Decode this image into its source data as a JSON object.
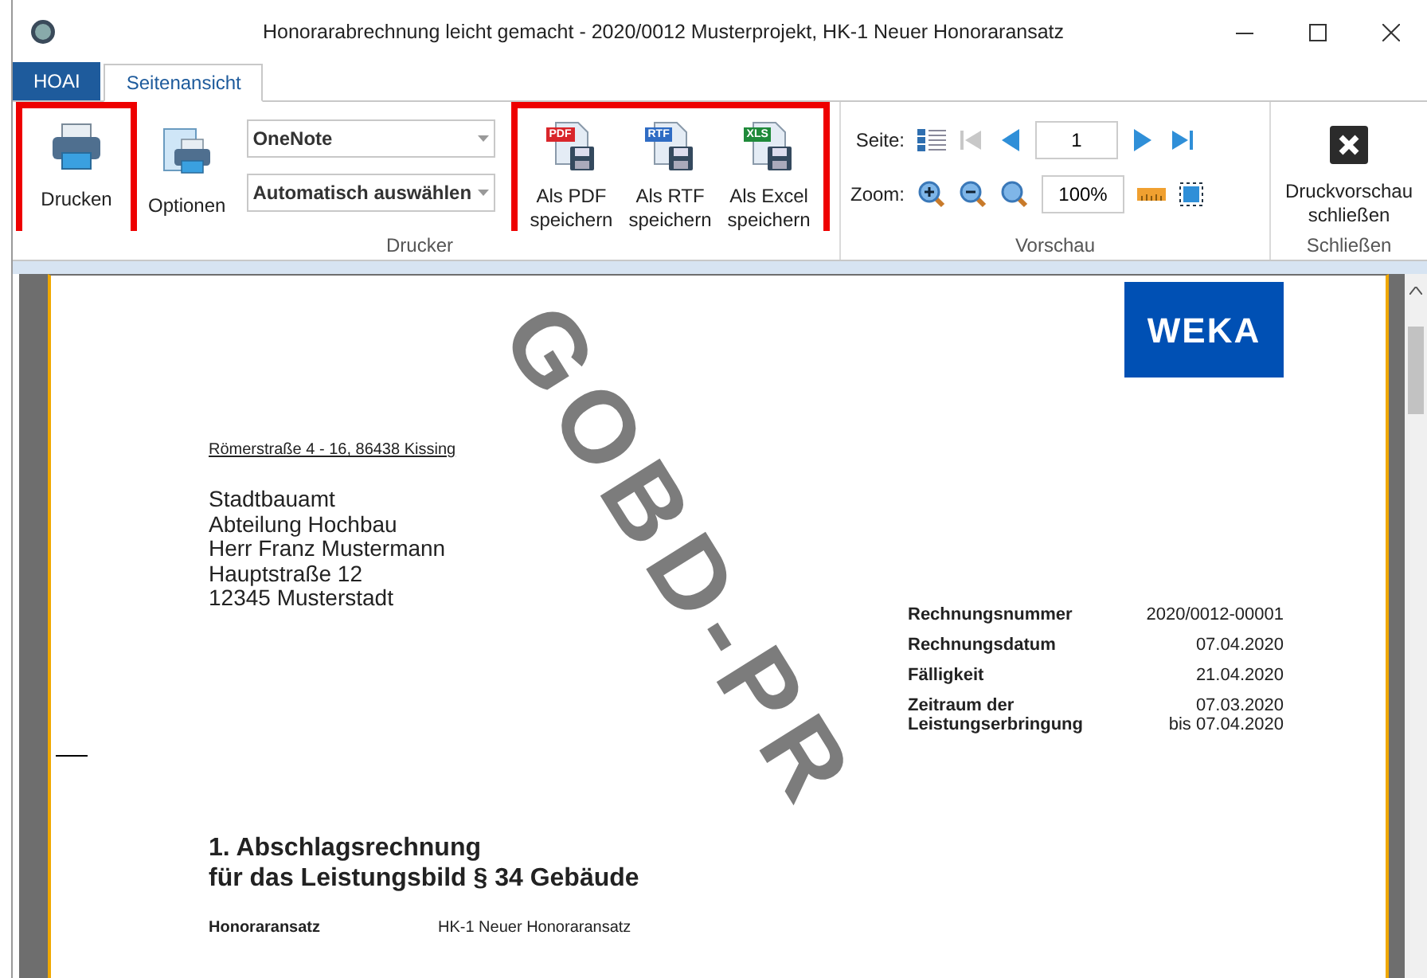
{
  "window": {
    "title": "Honorarabrechnung leicht gemacht - 2020/0012 Musterprojekt, HK-1 Neuer Honoraransatz"
  },
  "tabs": [
    {
      "label": "HOAI",
      "kind": "file",
      "selected": false
    },
    {
      "label": "Seitenansicht",
      "kind": "tab",
      "selected": true
    }
  ],
  "ribbon": {
    "printer_group": {
      "label": "Drucker",
      "print_button": {
        "label": "Drucken",
        "highlighted": true
      },
      "options_button": {
        "label": "Optionen"
      },
      "combos": [
        {
          "value": "OneNote"
        },
        {
          "value": "Automatisch auswählen"
        }
      ],
      "save_buttons": {
        "highlighted": true,
        "items": [
          {
            "label": "Als PDF\nspeichern",
            "badge": "PDF",
            "color": "#d9262b"
          },
          {
            "label": "Als RTF\nspeichern",
            "badge": "RTF",
            "color": "#2f6cc4"
          },
          {
            "label": "Als Excel\nspeichern",
            "badge": "XLS",
            "color": "#1f8a3a"
          }
        ]
      }
    },
    "preview_group": {
      "label": "Vorschau",
      "page_label": "Seite:",
      "page_value": "1",
      "zoom_label": "Zoom:",
      "zoom_value": "100%",
      "nav": [
        {
          "kind": "first",
          "disabled": true
        },
        {
          "kind": "prev",
          "disabled": false
        }
      ],
      "nav_after": [
        {
          "kind": "next",
          "disabled": false
        },
        {
          "kind": "last",
          "disabled": false
        }
      ]
    },
    "close_group": {
      "label": "Schließen",
      "button": {
        "label": "Druckvorschau\nschließen"
      }
    }
  },
  "document": {
    "logo": "WEKA",
    "sender_line": "Römerstraße 4 - 16, 86438 Kissing",
    "recipient": [
      "Stadtbauamt",
      "Abteilung Hochbau",
      "Herr Franz Mustermann",
      "Hauptstraße 12",
      "12345 Musterstadt"
    ],
    "info": [
      {
        "label": "Rechnungsnummer",
        "value": "2020/0012-00001"
      },
      {
        "label": "Rechnungsdatum",
        "value": "07.04.2020"
      },
      {
        "label": "Fälligkeit",
        "value": "21.04.2020"
      },
      {
        "label": "Zeitraum der\nLeistungserbringung",
        "value": "07.03.2020\nbis 07.04.2020"
      }
    ],
    "heading": "1. Abschlagsrechnung\nfür das Leistungsbild § 34 Gebäude",
    "details": [
      {
        "label": "Honoraransatz",
        "value": "HK-1 Neuer Honoraransatz"
      }
    ],
    "watermark": "GOBD-PR"
  }
}
